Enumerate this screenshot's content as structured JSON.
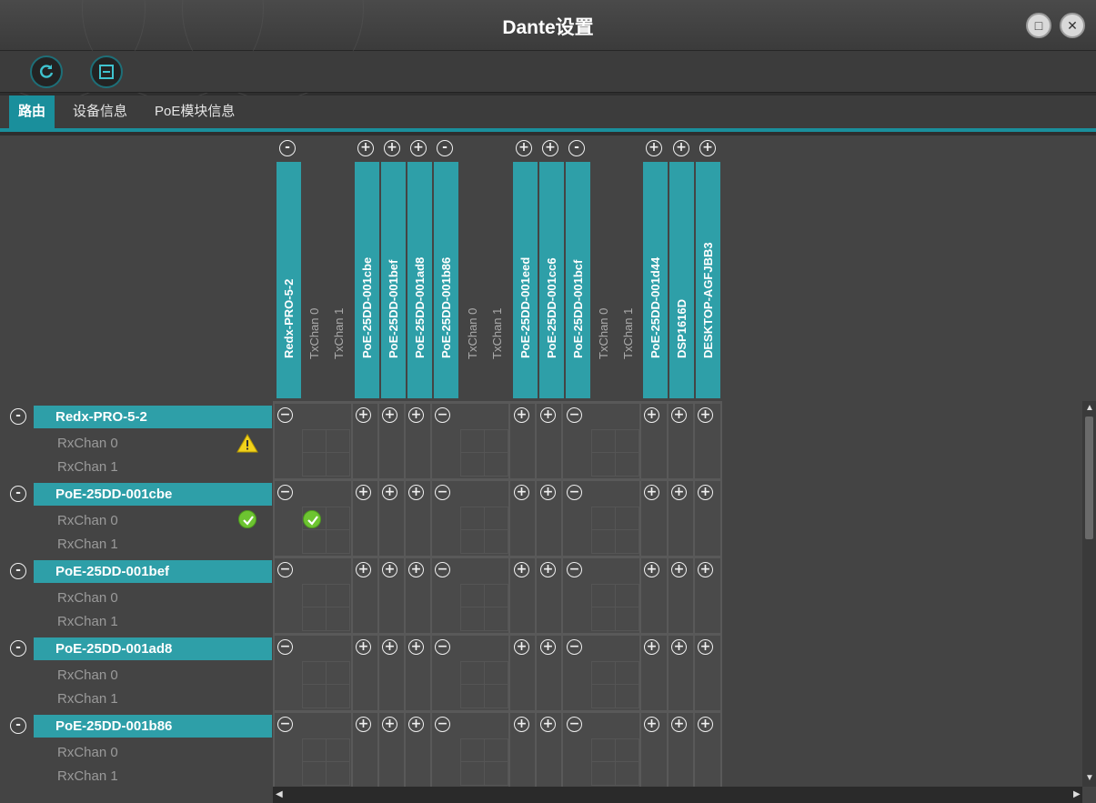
{
  "window": {
    "title": "Dante设置",
    "restore_icon": "restore-icon",
    "close_icon": "close-icon"
  },
  "toolbar": {
    "refresh_icon": "refresh-icon",
    "collapse_icon": "collapse-all-icon"
  },
  "tabs": [
    {
      "label": "路由",
      "active": true
    },
    {
      "label": "设备信息",
      "active": false
    },
    {
      "label": "PoE模块信息",
      "active": false
    }
  ],
  "columns": [
    {
      "name": "Redx-PRO-5-2",
      "toggle": "-",
      "tx": [
        "TxChan 0",
        "TxChan 1"
      ]
    },
    {
      "name": "PoE-25DD-001cbe",
      "toggle": "+"
    },
    {
      "name": "PoE-25DD-001bef",
      "toggle": "+"
    },
    {
      "name": "PoE-25DD-001ad8",
      "toggle": "+"
    },
    {
      "name": "PoE-25DD-001b86",
      "toggle": "-",
      "tx": [
        "TxChan 0",
        "TxChan 1"
      ]
    },
    {
      "name": "PoE-25DD-001eed",
      "toggle": "+"
    },
    {
      "name": "PoE-25DD-001cc6",
      "toggle": "+"
    },
    {
      "name": "PoE-25DD-001bcf",
      "toggle": "-",
      "tx": [
        "TxChan 0",
        "TxChan 1"
      ]
    },
    {
      "name": "PoE-25DD-001d44",
      "toggle": "+"
    },
    {
      "name": "DSP1616D",
      "toggle": "+"
    },
    {
      "name": "DESKTOP-AGFJBB3",
      "toggle": "+"
    }
  ],
  "rows": [
    {
      "name": "Redx-PRO-5-2",
      "toggle": "-",
      "rx": [
        "RxChan 0",
        "RxChan 1"
      ],
      "status": "warning",
      "status_icon": "warning-icon"
    },
    {
      "name": "PoE-25DD-001cbe",
      "toggle": "-",
      "rx": [
        "RxChan 0",
        "RxChan 1"
      ],
      "status": "ok",
      "status_icon": "check-icon",
      "route": "Redx-PRO-5-2 TxChan 0 → RxChan 0"
    },
    {
      "name": "PoE-25DD-001bef",
      "toggle": "-",
      "rx": [
        "RxChan 0",
        "RxChan 1"
      ]
    },
    {
      "name": "PoE-25DD-001ad8",
      "toggle": "-",
      "rx": [
        "RxChan 0",
        "RxChan 1"
      ]
    },
    {
      "name": "PoE-25DD-001b86",
      "toggle": "-",
      "rx": [
        "RxChan 0",
        "RxChan 1"
      ]
    }
  ],
  "colors": {
    "accent": "#2e9fa8",
    "tab_active": "#1a8f9c",
    "ok": "#6dc431",
    "warning": "#f2d21b"
  }
}
